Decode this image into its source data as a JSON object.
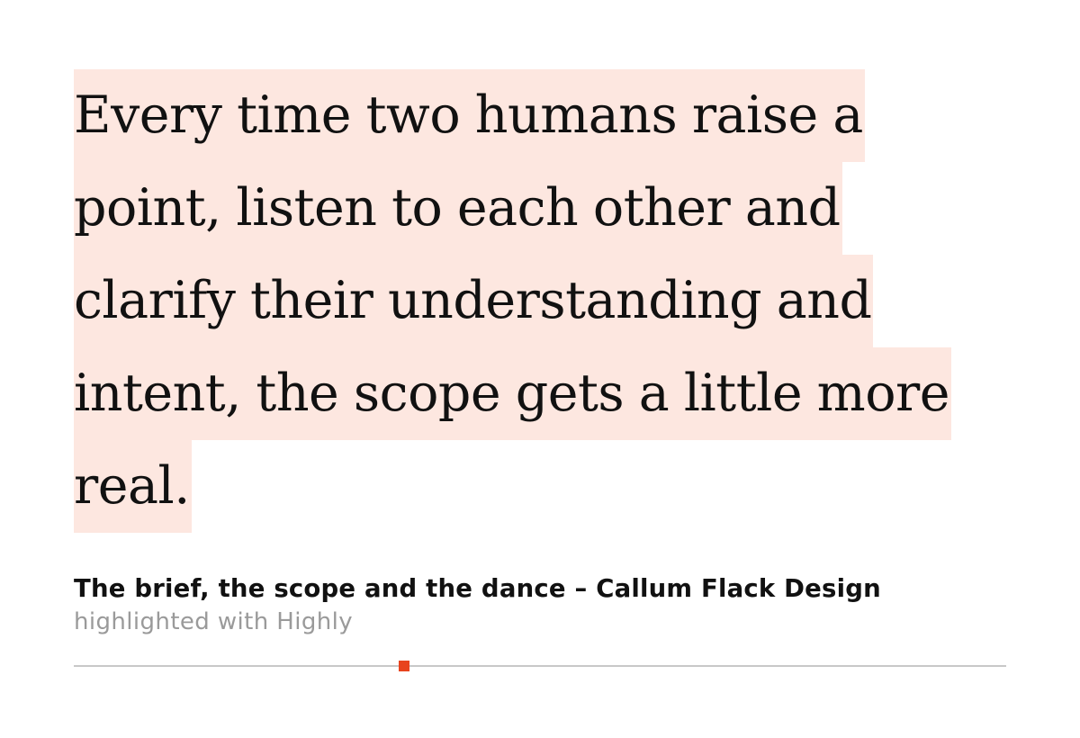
{
  "quote": {
    "lines": [
      "Every time two humans raise a",
      "point, listen to each other and",
      "clarify their understanding and",
      "intent, the scope gets a little more",
      "real."
    ]
  },
  "source": {
    "title": "The brief, the scope and the dance – Callum Flack Design",
    "credit": "highlighted with Highly"
  },
  "colors": {
    "highlight": "#fde7e0",
    "accent": "#e8431d",
    "divider": "#c8c8c8",
    "credit_text": "#9a9a9a"
  }
}
